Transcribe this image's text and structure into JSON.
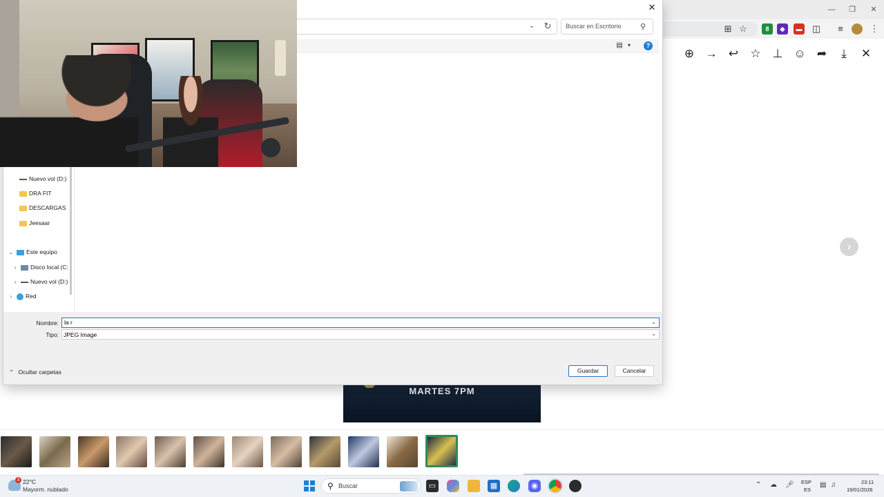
{
  "browser": {
    "toolbar_icons": [
      "install-icon",
      "bookmark-star-icon",
      "extension-green-icon",
      "extension-shield-icon",
      "extension-red-icon",
      "extensions-puzzle-icon",
      "tab-search-icon",
      "profile-avatar",
      "more-menu-icon"
    ],
    "ext_green_badge": "8",
    "viewer_icons": [
      "zoom-in-icon",
      "forward-icon",
      "reply-icon",
      "star-icon",
      "pin-icon",
      "emoji-icon",
      "share-icon",
      "download-icon",
      "close-icon"
    ],
    "poster_text": "MARTES 7PM",
    "thumbnails_count": 12,
    "selected_thumbnail_index": 11
  },
  "dialog": {
    "search_placeholder": "Buscar en Escritorio",
    "nav_items": [
      {
        "label": "Nuevo vol (D:)",
        "icon": "drive-icon"
      },
      {
        "label": "DRA FIT",
        "icon": "folder-icon"
      },
      {
        "label": "DESCARGAS",
        "icon": "folder-icon"
      },
      {
        "label": "Jeesaar",
        "icon": "folder-icon"
      },
      {
        "label": "Este equipo",
        "icon": "this-pc-icon"
      },
      {
        "label": "Disco local (C:",
        "icon": "local-disk-icon"
      },
      {
        "label": "Nuevo vol (D:)",
        "icon": "drive-icon"
      },
      {
        "label": "Red",
        "icon": "network-icon"
      }
    ],
    "name_label": "Nombre:",
    "name_value": "la r",
    "type_label": "Tipo:",
    "type_value": "JPEG Image",
    "hide_folders": "Ocultar carpetas",
    "save": "Guardar",
    "cancel": "Cancelar"
  },
  "taskbar": {
    "weather_badge": "3",
    "weather_temp": "22°C",
    "weather_desc": "Mayorm. nublado",
    "search_placeholder": "Buscar",
    "lang_top": "ESP",
    "lang_bottom": "ES",
    "time": "23:11",
    "date": "19/01/2026"
  }
}
